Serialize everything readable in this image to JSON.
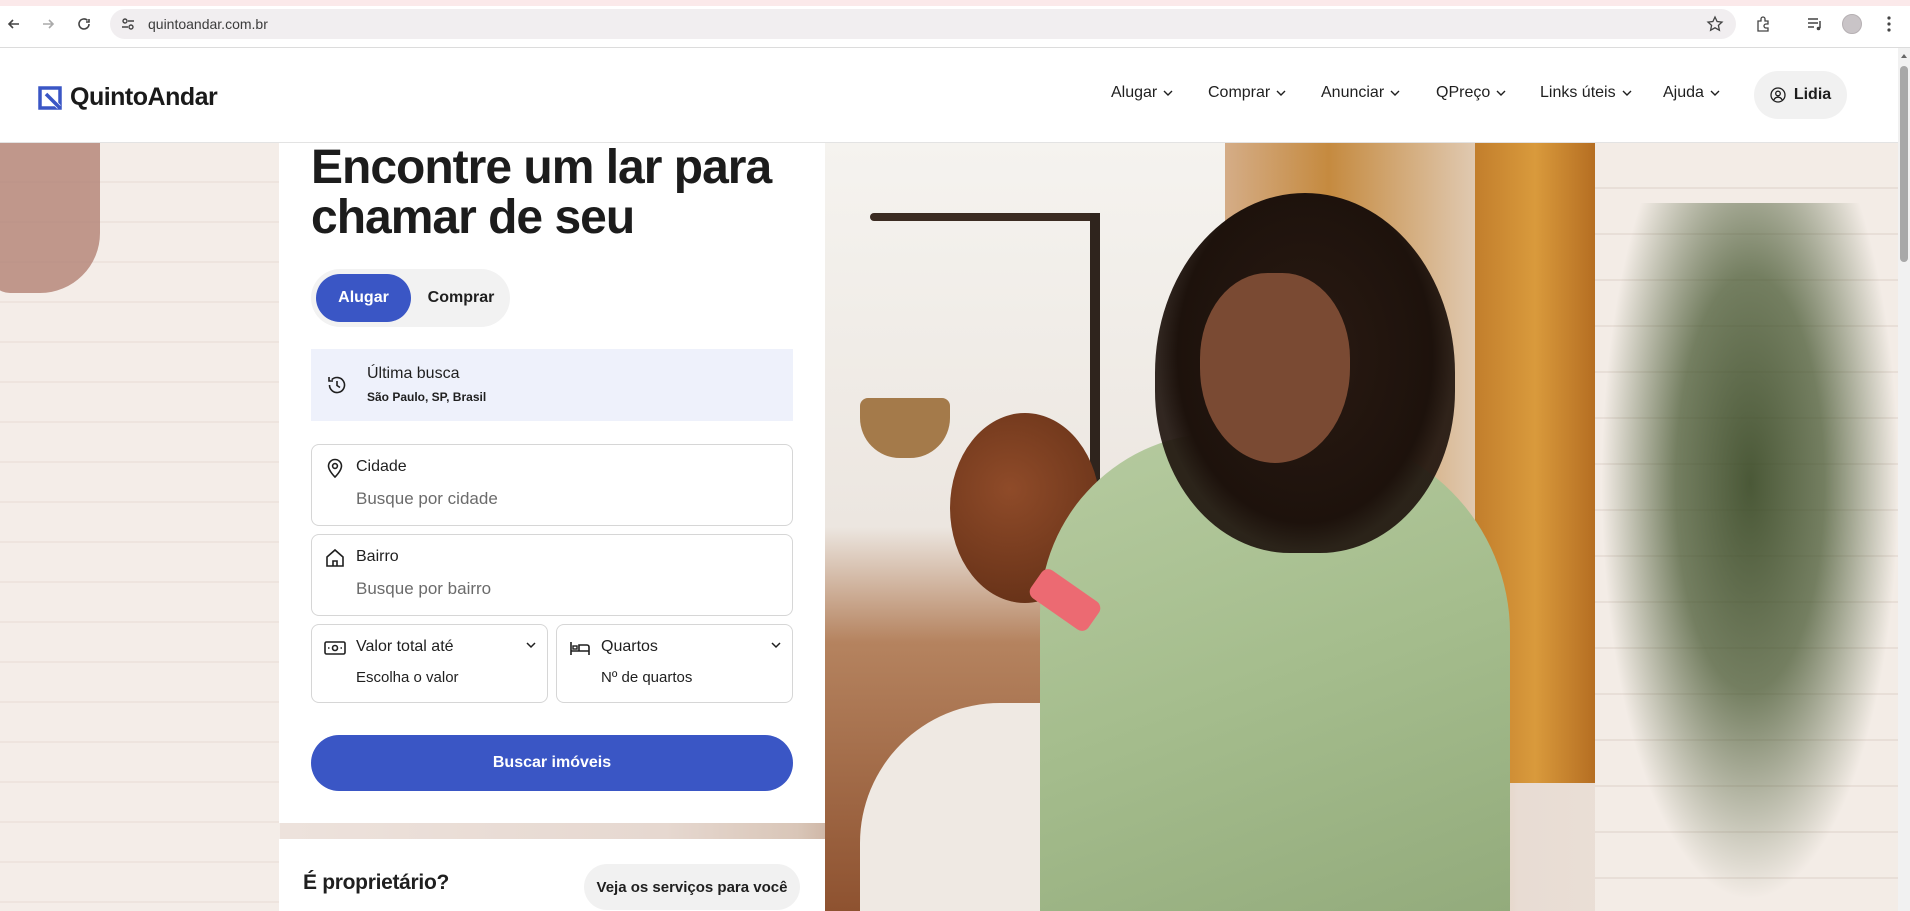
{
  "browser": {
    "url": "quintoandar.com.br"
  },
  "header": {
    "logo_text": "QuintoAndar",
    "nav": [
      {
        "label": "Alugar"
      },
      {
        "label": "Comprar"
      },
      {
        "label": "Anunciar"
      },
      {
        "label": "QPreço"
      },
      {
        "label": "Links úteis"
      },
      {
        "label": "Ajuda"
      }
    ],
    "user_name": "Lidia"
  },
  "search": {
    "headline": "Encontre um lar para chamar de seu",
    "mode_tabs": [
      "Alugar",
      "Comprar"
    ],
    "active_tab": "Alugar",
    "last_search": {
      "title": "Última busca",
      "location": "São Paulo, SP, Brasil"
    },
    "city": {
      "label": "Cidade",
      "placeholder": "Busque por cidade"
    },
    "neighborhood": {
      "label": "Bairro",
      "placeholder": "Busque por bairro"
    },
    "price": {
      "label": "Valor total até",
      "value": "Escolha o valor"
    },
    "rooms": {
      "label": "Quartos",
      "value": "Nº de quartos"
    },
    "submit_label": "Buscar imóveis"
  },
  "owner": {
    "title": "É proprietário?",
    "button_label": "Veja os serviços para você"
  },
  "colors": {
    "brand_blue": "#3a56c5",
    "last_search_bg": "#eef1fb"
  }
}
